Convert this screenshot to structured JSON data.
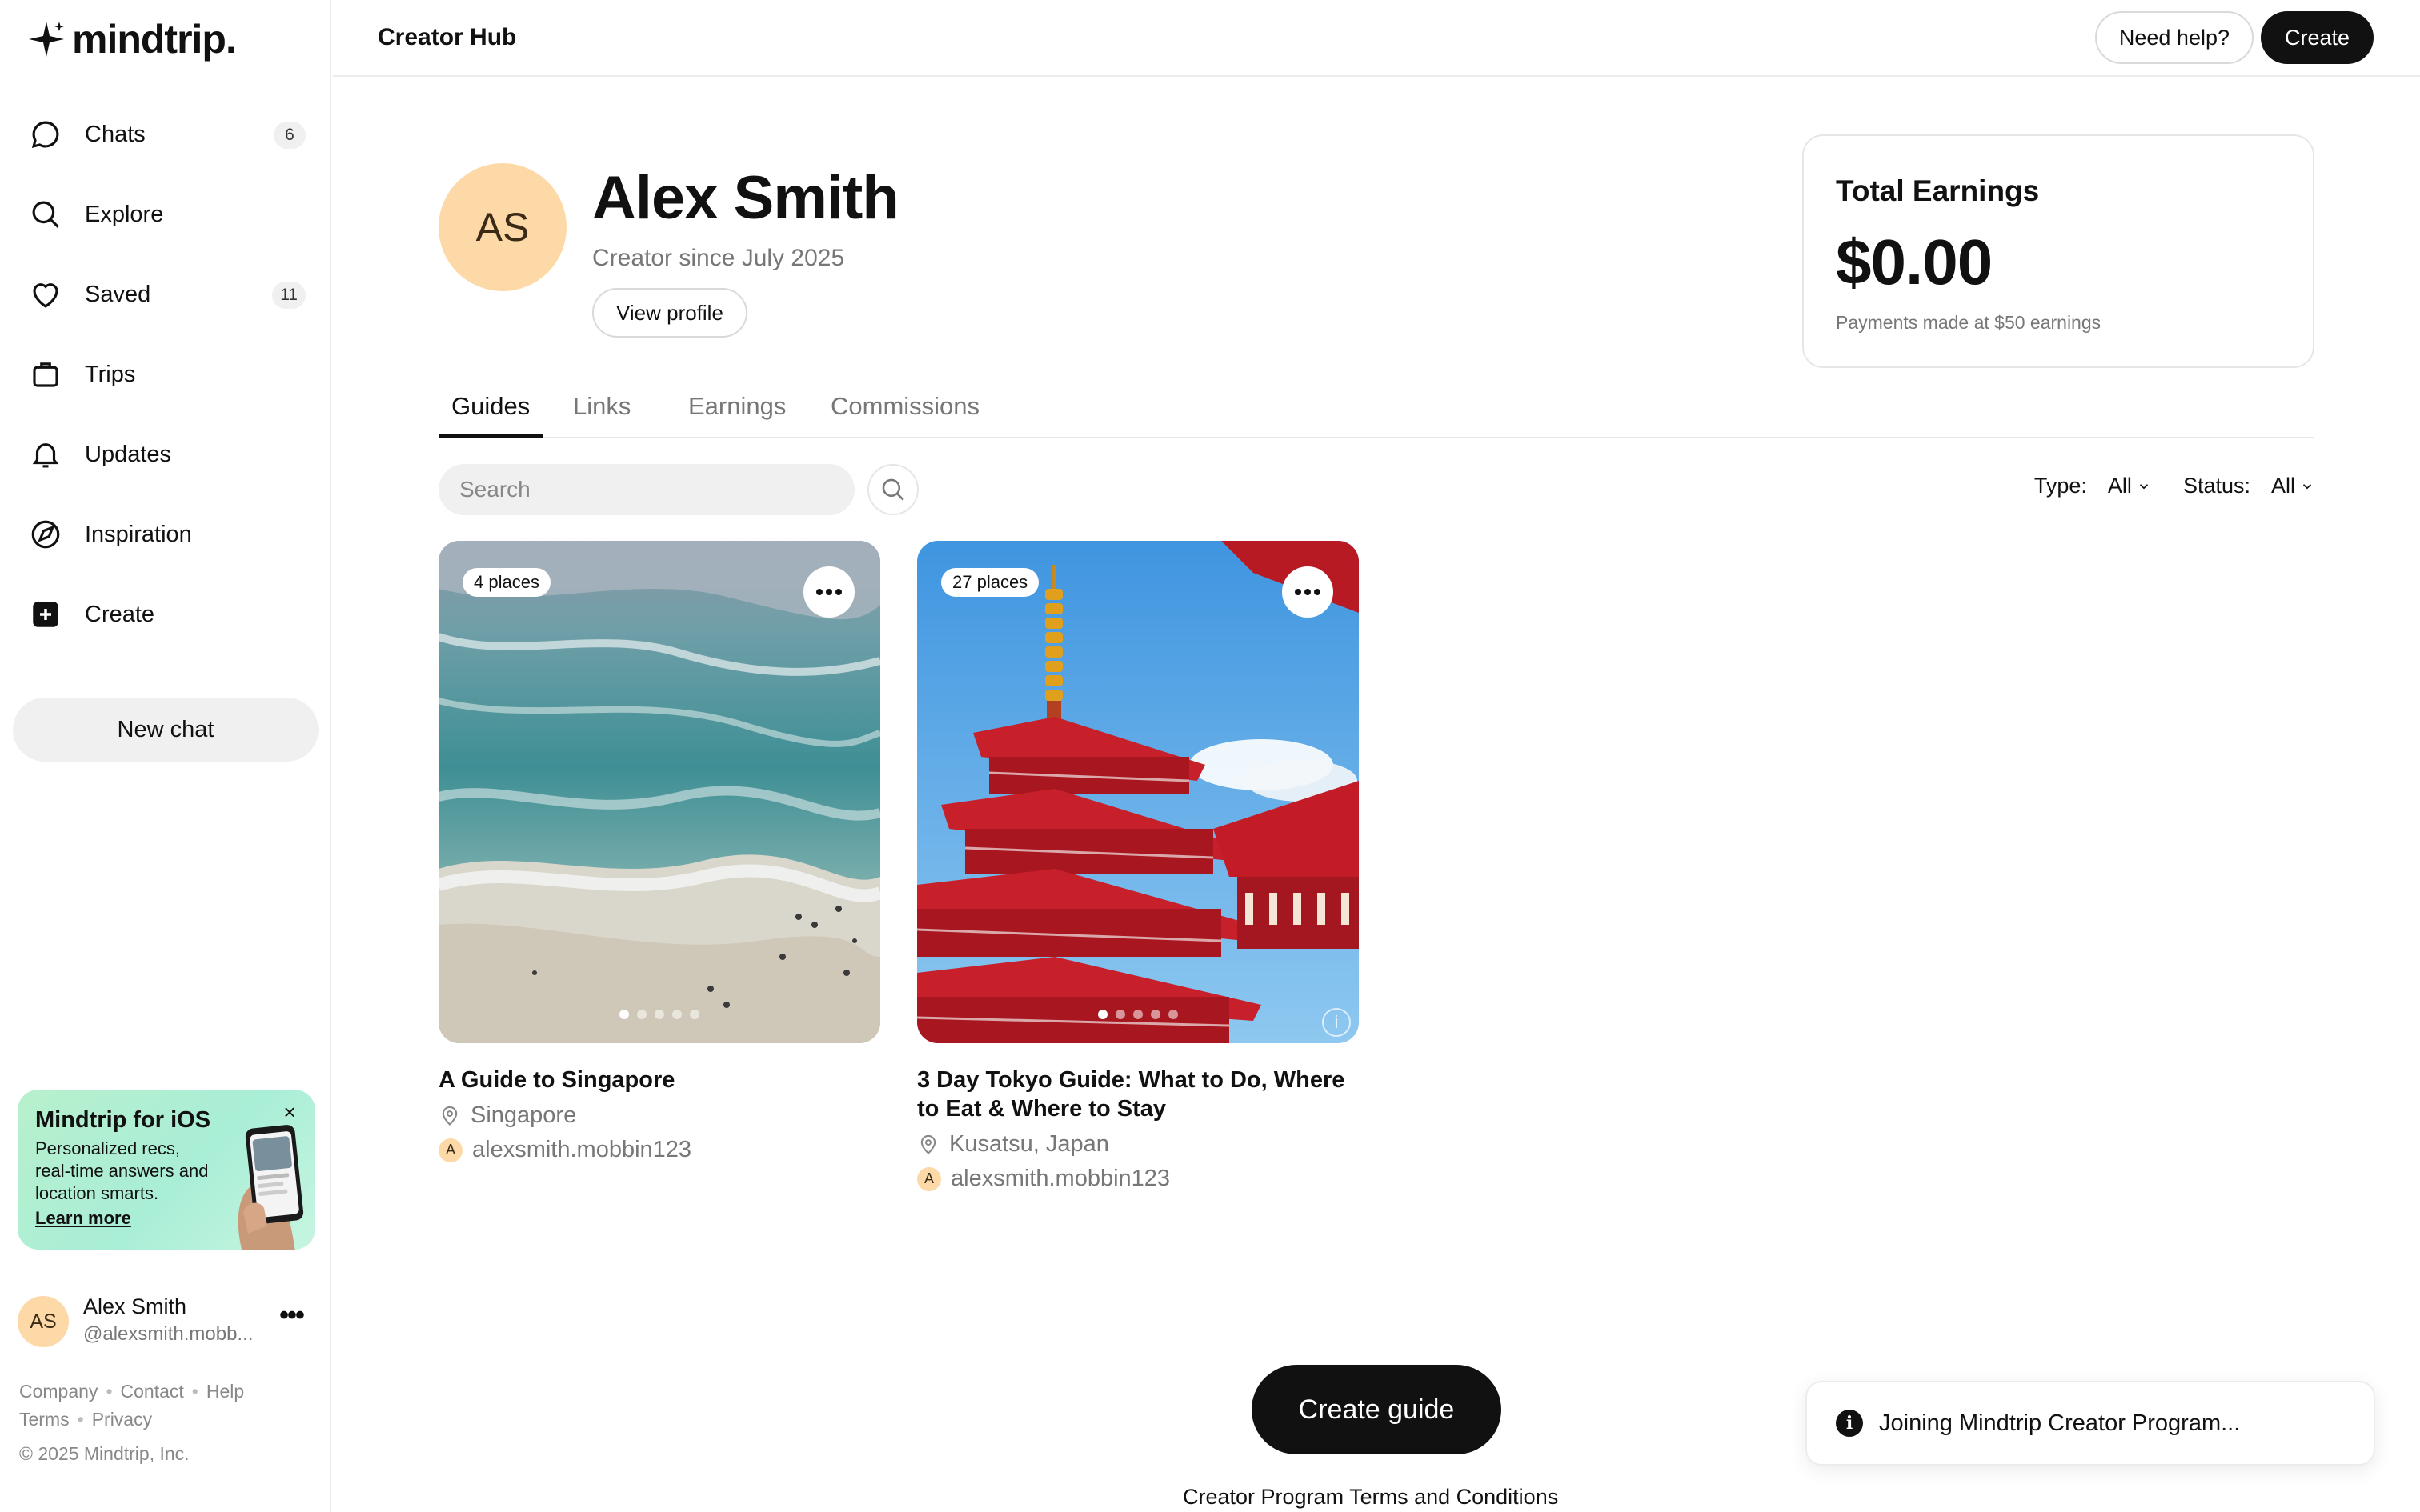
{
  "app": {
    "logo_text": "mindtrip."
  },
  "sidebar": {
    "items": [
      {
        "label": "Chats",
        "icon": "chat-bubble-icon",
        "badge": "6"
      },
      {
        "label": "Explore",
        "icon": "search-icon",
        "badge": ""
      },
      {
        "label": "Saved",
        "icon": "heart-icon",
        "badge": "11"
      },
      {
        "label": "Trips",
        "icon": "suitcase-icon",
        "badge": ""
      },
      {
        "label": "Updates",
        "icon": "bell-icon",
        "badge": ""
      },
      {
        "label": "Inspiration",
        "icon": "compass-icon",
        "badge": ""
      },
      {
        "label": "Create",
        "icon": "plus-square-icon",
        "badge": ""
      }
    ],
    "new_chat_label": "New chat",
    "promo": {
      "title": "Mindtrip for iOS",
      "text": "Personalized recs, real-time answers and location smarts.",
      "link": "Learn more",
      "close": "×"
    },
    "user": {
      "initials": "AS",
      "name": "Alex Smith",
      "handle": "@alexsmith.mobb..."
    },
    "footer": {
      "company": "Company",
      "contact": "Contact",
      "help": "Help",
      "terms": "Terms",
      "privacy": "Privacy",
      "copyright": "© 2025 Mindtrip, Inc."
    }
  },
  "header": {
    "title": "Creator Hub",
    "need_help": "Need help?",
    "create": "Create"
  },
  "profile": {
    "initials": "AS",
    "name": "Alex Smith",
    "since": "Creator since July 2025",
    "view_profile": "View profile"
  },
  "earnings": {
    "title": "Total Earnings",
    "value": "$0.00",
    "note": "Payments made at $50 earnings"
  },
  "tabs": [
    "Guides",
    "Links",
    "Earnings",
    "Commissions"
  ],
  "search": {
    "placeholder": "Search"
  },
  "filters": {
    "type_label": "Type:",
    "type_value": "All",
    "status_label": "Status:",
    "status_value": "All"
  },
  "guides": [
    {
      "places": "4 places",
      "title": "A Guide to Singapore",
      "location": "Singapore",
      "author_initial": "A",
      "author": "alexsmith.mobbin123",
      "image": "aerial-beach-waves"
    },
    {
      "places": "27 places",
      "title": "3 Day Tokyo Guide: What to Do, Where to Eat & Where to Stay",
      "location": "Kusatsu, Japan",
      "author_initial": "A",
      "author": "alexsmith.mobbin123",
      "image": "red-pagoda-sky"
    }
  ],
  "actions": {
    "create_guide": "Create guide",
    "terms": "Creator Program Terms and Conditions"
  },
  "toast": {
    "icon": "i",
    "text": "Joining Mindtrip Creator Program..."
  }
}
